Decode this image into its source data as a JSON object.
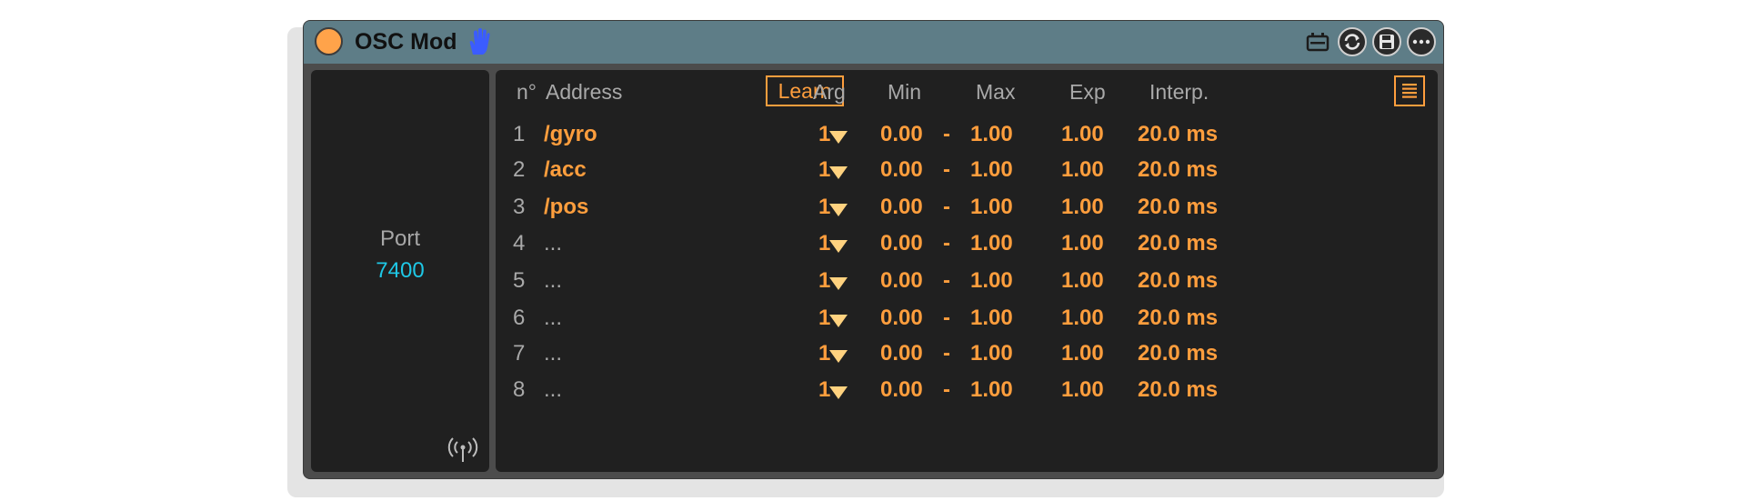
{
  "device": {
    "title": "OSC Mod",
    "power_color": "#ffa34a",
    "titlebar_color": "#5e7d87",
    "accent_color": "#ff9e3d",
    "port_color": "#1ec8e6"
  },
  "left": {
    "port_label": "Port",
    "port_value": "7400"
  },
  "headers": {
    "num": "n°",
    "address": "Address",
    "learn": "Learn",
    "arg": "Arg",
    "min": "Min",
    "max": "Max",
    "exp": "Exp",
    "interp": "Interp."
  },
  "rows": [
    {
      "n": "1",
      "address": "/gyro",
      "arg": "1",
      "min": "0.00",
      "sep": "-",
      "max": "1.00",
      "exp": "1.00",
      "interp": "20.0 ms"
    },
    {
      "n": "2",
      "address": "/acc",
      "arg": "1",
      "min": "0.00",
      "sep": "-",
      "max": "1.00",
      "exp": "1.00",
      "interp": "20.0 ms"
    },
    {
      "n": "3",
      "address": "/pos",
      "arg": "1",
      "min": "0.00",
      "sep": "-",
      "max": "1.00",
      "exp": "1.00",
      "interp": "20.0 ms"
    },
    {
      "n": "4",
      "address": "...",
      "arg": "1",
      "min": "0.00",
      "sep": "-",
      "max": "1.00",
      "exp": "1.00",
      "interp": "20.0 ms"
    },
    {
      "n": "5",
      "address": "...",
      "arg": "1",
      "min": "0.00",
      "sep": "-",
      "max": "1.00",
      "exp": "1.00",
      "interp": "20.0 ms"
    },
    {
      "n": "6",
      "address": "...",
      "arg": "1",
      "min": "0.00",
      "sep": "-",
      "max": "1.00",
      "exp": "1.00",
      "interp": "20.0 ms"
    },
    {
      "n": "7",
      "address": "...",
      "arg": "1",
      "min": "0.00",
      "sep": "-",
      "max": "1.00",
      "exp": "1.00",
      "interp": "20.0 ms"
    },
    {
      "n": "8",
      "address": "...",
      "arg": "1",
      "min": "0.00",
      "sep": "-",
      "max": "1.00",
      "exp": "1.00",
      "interp": "20.0 ms"
    }
  ],
  "icons": {
    "hand": "hand-icon",
    "clip": "clip-icon",
    "refresh": "refresh-icon",
    "save": "save-icon",
    "more": "more-icon",
    "list": "list-icon",
    "antenna": "antenna-icon"
  }
}
